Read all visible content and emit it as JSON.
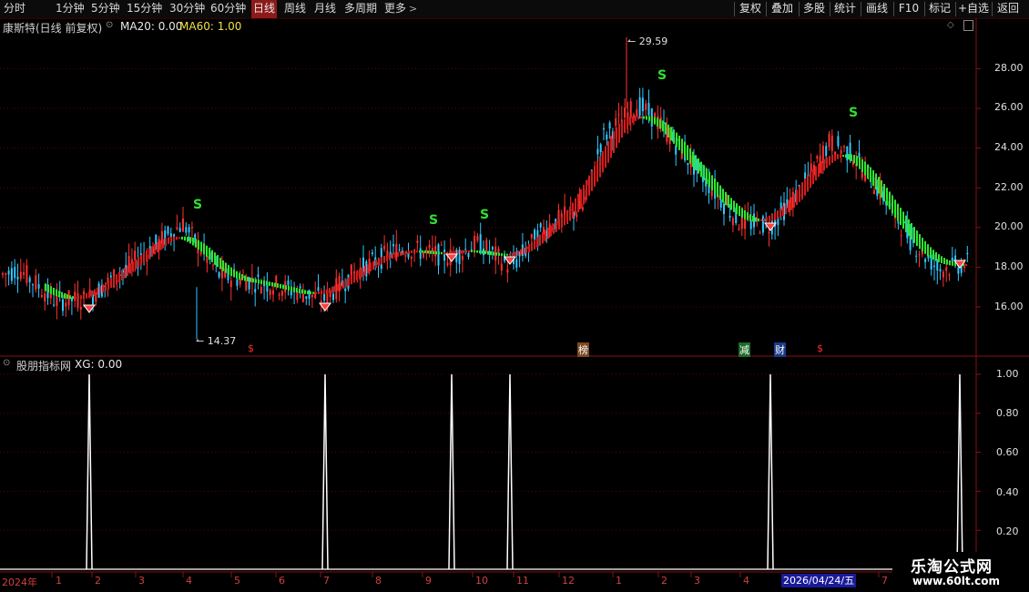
{
  "toolbar": {
    "periods": [
      "分时",
      "1分钟",
      "5分钟",
      "15分钟",
      "30分钟",
      "60分钟",
      "日线",
      "周线",
      "月线",
      "多周期",
      "更多"
    ],
    "active_period": "日线",
    "right_buttons": [
      "复权",
      "叠加",
      "多股",
      "统计",
      "画线",
      "F10",
      "标记",
      "+自选",
      "返回"
    ]
  },
  "main_chart": {
    "title": "康斯特(日线 前复权)",
    "ma20_label": "MA20: 0.00",
    "ma60_label": "MA60: 1.00",
    "high_label": "29.59",
    "low_label": "14.37",
    "y_ticks": [
      "28.00",
      "26.00",
      "24.00",
      "22.00",
      "20.00",
      "18.00",
      "16.00"
    ],
    "signal_char": "S",
    "markers": [
      {
        "text": "$",
        "color": "#ff3030"
      },
      {
        "text": "榜",
        "color": "#ffffff",
        "bg": "#7a4a20"
      },
      {
        "text": "减",
        "color": "#ffffff",
        "bg": "#1f6a2a"
      },
      {
        "text": "财",
        "color": "#ffffff",
        "bg": "#1a3a8a"
      },
      {
        "text": "$",
        "color": "#ff3030"
      }
    ]
  },
  "indicator": {
    "title": "股朋指标网",
    "xg_label": "XG: 0.00",
    "y_ticks": [
      "1.00",
      "0.80",
      "0.60",
      "0.40",
      "0.20"
    ]
  },
  "time_axis": {
    "year_label": "2024年",
    "months": [
      "1",
      "2",
      "3",
      "4",
      "5",
      "6",
      "7",
      "8",
      "9",
      "10",
      "11",
      "12",
      "1",
      "2",
      "3",
      "4",
      "7"
    ],
    "cursor_date": "2026/04/24/五"
  },
  "watermark": {
    "name": "乐淘公式网",
    "url": "www.60lt.com"
  },
  "colors": {
    "up": "#ff3030",
    "down": "#30c8ff",
    "ribbon_up": "#d41c1c",
    "ribbon_down": "#2ee82e",
    "grid": "#5a0000",
    "signal": "#ffffff"
  },
  "chart_data": {
    "type": "candlestick",
    "price_ylim": [
      14,
      30
    ],
    "signal_ylim": [
      0,
      1
    ],
    "signals": [
      1,
      1,
      1,
      1,
      1,
      1
    ]
  }
}
